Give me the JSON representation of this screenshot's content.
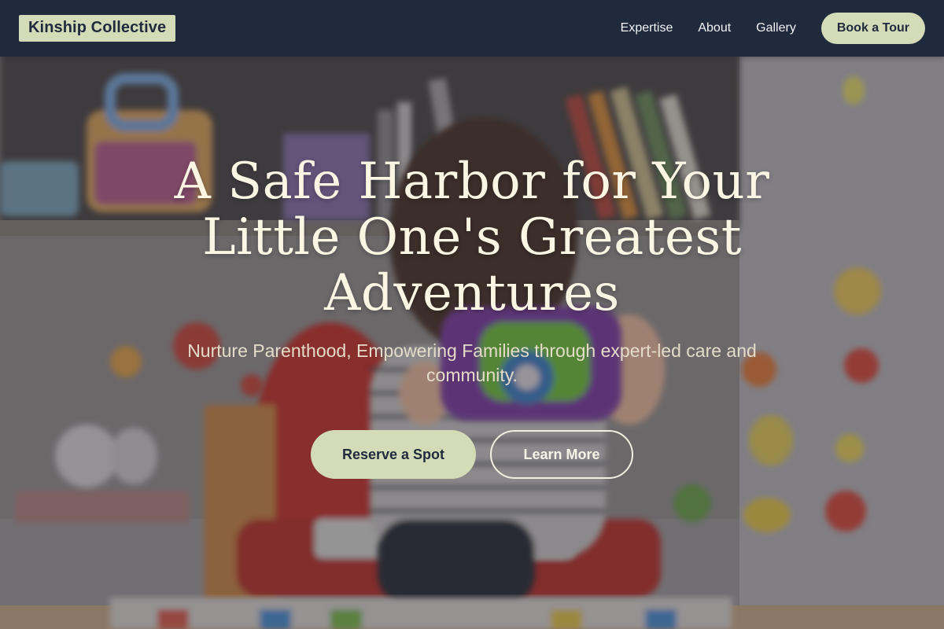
{
  "navbar": {
    "brand": "Kinship Collective",
    "links": [
      {
        "label": "Expertise"
      },
      {
        "label": "About"
      },
      {
        "label": "Gallery"
      }
    ],
    "cta_label": "Book a Tour"
  },
  "hero": {
    "title": "A Safe Harbor for Your Little One's Greatest Adventures",
    "subtitle": "Nurture Parenthood, Empowering Families through expert-led care and community.",
    "primary_button": "Reserve a Spot",
    "secondary_button": "Learn More",
    "background_image": "toddler-with-toy-camera-photo"
  },
  "colors": {
    "navbar_bg": "#1f2a3d",
    "accent": "#d3dbb7",
    "title_text": "#fbf6e4",
    "subtitle_text": "#e4dcc9"
  }
}
